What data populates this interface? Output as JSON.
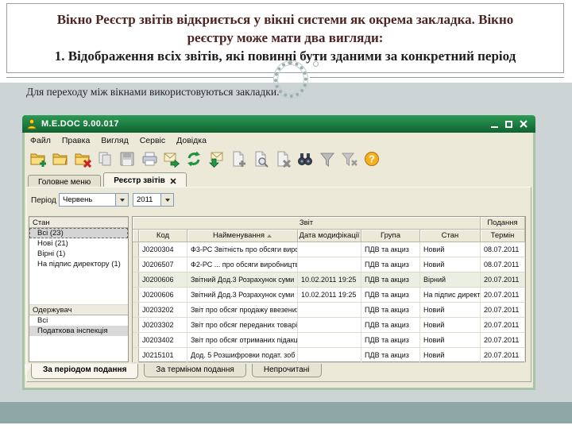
{
  "slide": {
    "heading_lines": [
      "Вікно Реєстр звітів відкриється у вікні системи як окрема закладка. Вікно",
      "реєстру може мати два вигляди:",
      "1. Відображення всіх звітів, які повинні бути зданими за конкретний період"
    ],
    "subtitle": "Для переходу між вікнами використовуються закладки.",
    "colors": {
      "heading_text": "#4c2422",
      "band": "#ccd4d6",
      "footer_band": "#8da8a6"
    }
  },
  "window": {
    "title": "M.E.DOC 9.00.017",
    "window_controls": [
      "minimize-icon",
      "maximize-icon",
      "close-icon"
    ],
    "menu": [
      "Файл",
      "Правка",
      "Вигляд",
      "Сервіс",
      "Довідка"
    ],
    "toolbar_icons": [
      "folder-new-icon",
      "folder-open-icon",
      "folder-delete-icon",
      "copy-icon",
      "save-icon",
      "print-icon",
      "mail-send-icon",
      "refresh-icon",
      "mail-receive-icon",
      "document-add-icon",
      "document-search-icon",
      "document-delete-icon",
      "binoculars-icon",
      "filter-icon",
      "filter-clear-icon",
      "help-icon"
    ],
    "tabs": [
      {
        "label": "Головне меню",
        "active": false
      },
      {
        "label": "Реєстр звітів",
        "active": true,
        "closable": true
      }
    ],
    "period": {
      "label": "Період",
      "month": "Червень",
      "year": "2011"
    },
    "sidebar": {
      "sections": [
        {
          "title": "Стан",
          "items": [
            {
              "label": "Всі (23)",
              "selected": true
            },
            {
              "label": "Нові (21)"
            },
            {
              "label": "Вірні (1)"
            },
            {
              "label": "На підпис директору (1)"
            }
          ]
        },
        {
          "title": "Одержувач",
          "items": [
            {
              "label": "Всі"
            },
            {
              "label": "Податкова інспекція",
              "highlighted": true
            }
          ]
        }
      ]
    },
    "table": {
      "group_headers": [
        "Звіт",
        "Подання"
      ],
      "columns": [
        "Код",
        "Найменування",
        "Дата модифікації",
        "Група",
        "Стан",
        "Термін"
      ],
      "rows": [
        {
          "code": "J0200304",
          "name": "Ф3-РС  Звітність про обсяги виро",
          "modified": "",
          "group": "ПДВ та акциз",
          "state": "Новий",
          "term": "08.07.2011"
        },
        {
          "code": "J0206507",
          "name": "Ф2-РС  ... про обсяги виробництв",
          "modified": "",
          "group": "ПДВ та акциз",
          "state": "Новий",
          "term": "08.07.2011"
        },
        {
          "code": "J0200606",
          "name": "Звітний  Дод.3 Розрахунок суми",
          "modified": "10.02.2011 19:25",
          "group": "ПДВ та акциз",
          "state": "Вірний",
          "term": "20.07.2011"
        },
        {
          "code": "J0200606",
          "name": "Звітний  Дод.3 Розрахунок суми",
          "modified": "10.02.2011 19:25",
          "group": "ПДВ та акциз",
          "state": "На підпис директору",
          "term": "20.07.2011"
        },
        {
          "code": "J0203202",
          "name": "Звіт про обсяг продажу ввезених",
          "modified": "",
          "group": "ПДВ та акциз",
          "state": "Новий",
          "term": "20.07.2011"
        },
        {
          "code": "J0203302",
          "name": "Звіт про обсяг переданих товарів,",
          "modified": "",
          "group": "ПДВ та акциз",
          "state": "Новий",
          "term": "20.07.2011"
        },
        {
          "code": "J0203402",
          "name": "Звіт про обсяг отриманих підакци",
          "modified": "",
          "group": "ПДВ та акциз",
          "state": "Новий",
          "term": "20.07.2011"
        },
        {
          "code": "J0215101",
          "name": "Дод. 5 Розшифровки подат. зоб",
          "modified": "",
          "group": "ПДВ та акциз",
          "state": "Новий",
          "term": "20.07.2011"
        }
      ]
    },
    "bottom_tabs": [
      "За періодом подання",
      "За терміном подання",
      "Непрочитані"
    ]
  }
}
